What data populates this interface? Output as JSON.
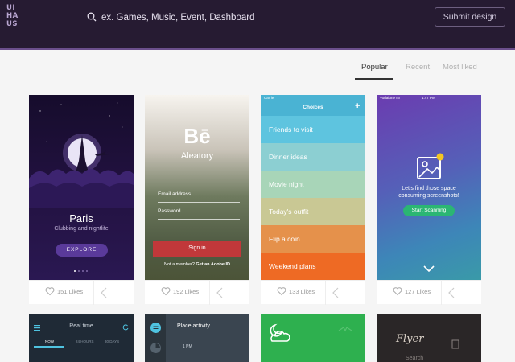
{
  "header": {
    "logo_lines": [
      "UI",
      "HA",
      "US"
    ],
    "search_placeholder": "ex. Games, Music, Event, Dashboard",
    "submit_label": "Submit design"
  },
  "tabs": [
    {
      "label": "Popular",
      "active": true
    },
    {
      "label": "Recent",
      "active": false
    },
    {
      "label": "Most liked",
      "active": false
    }
  ],
  "cards": [
    {
      "likes": "151 Likes",
      "screen": {
        "title": "Paris",
        "subtitle": "Clubbing and nightlife",
        "button": "EXPLORE"
      }
    },
    {
      "likes": "192 Likes",
      "screen": {
        "logo": "Bē",
        "title": "Aleatory",
        "email_label": "Email address",
        "password_label": "Password",
        "button": "Sign in",
        "member_text": "Not a member?",
        "member_link": "Get an Adobe ID"
      }
    },
    {
      "likes": "133 Likes",
      "screen": {
        "carrier": "Carrier",
        "title": "Choices",
        "items": [
          {
            "label": "Friends to visit",
            "color": "#5ec4df"
          },
          {
            "label": "Dinner ideas",
            "color": "#8ccfd2"
          },
          {
            "label": "Movie night",
            "color": "#a8d5b8"
          },
          {
            "label": "Today's outfit",
            "color": "#c9c894"
          },
          {
            "label": "Flip a coin",
            "color": "#e5914b"
          },
          {
            "label": "Weekend plans",
            "color": "#ee6a24"
          }
        ]
      }
    },
    {
      "likes": "127 Likes",
      "screen": {
        "carrier": "Vodafone IN",
        "time": "1:47 PM",
        "text": "Let's find those space consuming screenshots!",
        "button": "Start Scanning"
      }
    }
  ],
  "row2": [
    {
      "title": "Real time",
      "tabs": [
        "NOW",
        "24 HOURS",
        "30 DAYS"
      ]
    },
    {
      "title": "Place activity",
      "time": "1 PM"
    },
    {
      "title": ""
    },
    {
      "title": "Flyer",
      "search": "Search"
    }
  ],
  "colors": {
    "header_bg": "#261b32",
    "accent_line": "#6b4f8c",
    "page_bg": "#f5f5f5"
  }
}
